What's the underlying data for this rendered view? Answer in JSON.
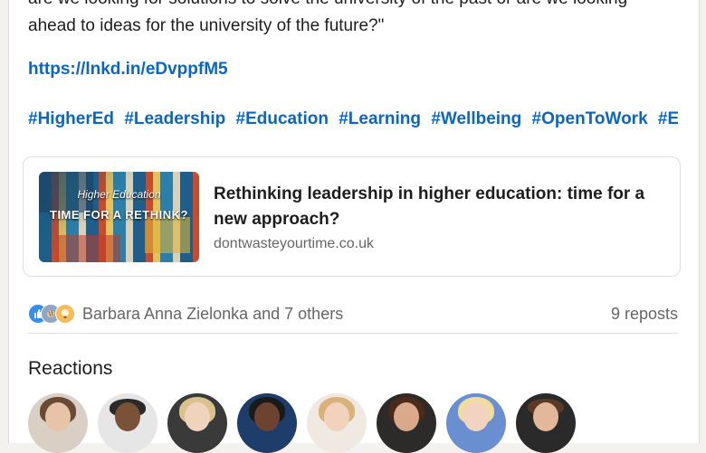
{
  "post": {
    "text_line1": "are we looking for solutions to solve the university of the past or are we looking",
    "text_line2": "ahead to ideas for the university of the future?\"",
    "link": "https://lnkd.in/eDvppfM5",
    "hashtags": [
      "#HigherEd",
      "#Leadership",
      "#Education",
      "#Learning",
      "#Wellbeing",
      "#OpenToWork",
      "#Ed"
    ]
  },
  "link_card": {
    "thumb_line1": "Higher Education",
    "thumb_line2": "TIME FOR A RETHINK?",
    "title": "Rethinking leadership in higher education: time for a new approach?",
    "domain": "dontwasteyourtime.co.uk"
  },
  "social": {
    "reaction_icons": [
      "like-icon",
      "clap-icon",
      "idea-icon"
    ],
    "names": "Barbara Anna Zielonka and 7 others",
    "reposts": "9 reposts"
  },
  "reactions": {
    "title": "Reactions",
    "avatars": [
      {
        "name": "reactor-avatar-1"
      },
      {
        "name": "reactor-avatar-2"
      },
      {
        "name": "reactor-avatar-3"
      },
      {
        "name": "reactor-avatar-4"
      },
      {
        "name": "reactor-avatar-5"
      },
      {
        "name": "reactor-avatar-6"
      },
      {
        "name": "reactor-avatar-7"
      },
      {
        "name": "reactor-avatar-8"
      }
    ]
  },
  "colors": {
    "link_blue": "#0a66c2",
    "muted_text": "#666666",
    "background": "#f3f2ee"
  }
}
